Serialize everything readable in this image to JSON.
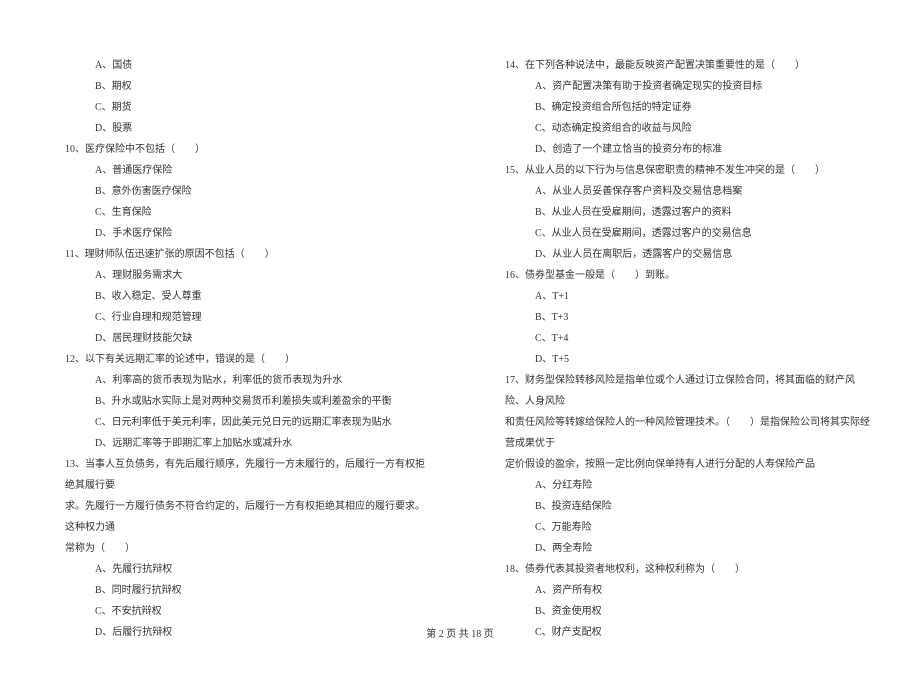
{
  "left_column": {
    "q9_options": {
      "a": "A、国债",
      "b": "B、期权",
      "c": "C、期货",
      "d": "D、股票"
    },
    "q10": {
      "stem": "10、医疗保险中不包括（　　）",
      "a": "A、普通医疗保险",
      "b": "B、意外伤害医疗保险",
      "c": "C、生育保险",
      "d": "D、手术医疗保险"
    },
    "q11": {
      "stem": "11、理财师队伍迅速扩张的原因不包括（　　）",
      "a": "A、理财服务需求大",
      "b": "B、收入稳定、受人尊重",
      "c": "C、行业自理和规范管理",
      "d": "D、居民理财技能欠缺"
    },
    "q12": {
      "stem": "12、以下有关远期汇率的论述中，错误的是（　　）",
      "a": "A、利率高的货币表现为贴水，利率低的货币表现为升水",
      "b": "B、升水或贴水实际上是对两种交易货币利差损失或利差盈余的平衡",
      "c": "C、日元利率低于美元利率，因此美元兑日元的远期汇率表现为贴水",
      "d": "D、远期汇率等于即期汇率上加贴水或减升水"
    },
    "q13": {
      "stem_l1": "13、当事人互负债务，有先后履行顺序，先履行一方未履行的，后履行一方有权拒绝其履行要",
      "stem_l2": "求。先履行一方履行债务不符合约定的，后履行一方有权拒绝其相应的履行要求。这种权力通",
      "stem_l3": "常称为（　　）",
      "a": "A、先履行抗辩权",
      "b": "B、同时履行抗辩权",
      "c": "C、不安抗辩权",
      "d": "D、后履行抗辩权"
    }
  },
  "right_column": {
    "q14": {
      "stem": "14、在下列各种说法中，最能反映资产配置决策重要性的是（　　）",
      "a": "A、资产配置决策有助于投资者确定现实的投资目标",
      "b": "B、确定投资组合所包括的特定证券",
      "c": "C、动态确定投资组合的收益与风险",
      "d": "D、创造了一个建立恰当的投资分布的标准"
    },
    "q15": {
      "stem": "15、从业人员的以下行为与信息保密职责的精神不发生冲突的是（　　）",
      "a": "A、从业人员妥善保存客户资料及交易信息档案",
      "b": "B、从业人员在受雇期间，透露过客户的资料",
      "c": "C、从业人员在受雇期间，透露过客户的交易信息",
      "d": "D、从业人员在离职后，透露客户的交易信息"
    },
    "q16": {
      "stem": "16、债券型基金一般是（　　）到账。",
      "a": "A、T+1",
      "b": "B、T+3",
      "c": "C、T+4",
      "d": "D、T+5"
    },
    "q17": {
      "stem_l1": "17、财务型保险转移风险是指单位或个人通过订立保险合同，将其面临的财产风险、人身风险",
      "stem_l2": "和责任风险等转嫁给保险人的一种风险管理技术。（　　）是指保险公司将其实际经营成果优于",
      "stem_l3": "定价假设的盈余，按照一定比例向保单持有人进行分配的人寿保险产品",
      "a": "A、分红寿险",
      "b": "B、投资连结保险",
      "c": "C、万能寿险",
      "d": "D、两全寿险"
    },
    "q18": {
      "stem": "18、债券代表其投资者地权利，这种权利称为（　　）",
      "a": "A、资产所有权",
      "b": "B、资金使用权",
      "c": "C、财产支配权"
    }
  },
  "footer": "第 2 页 共 18 页"
}
